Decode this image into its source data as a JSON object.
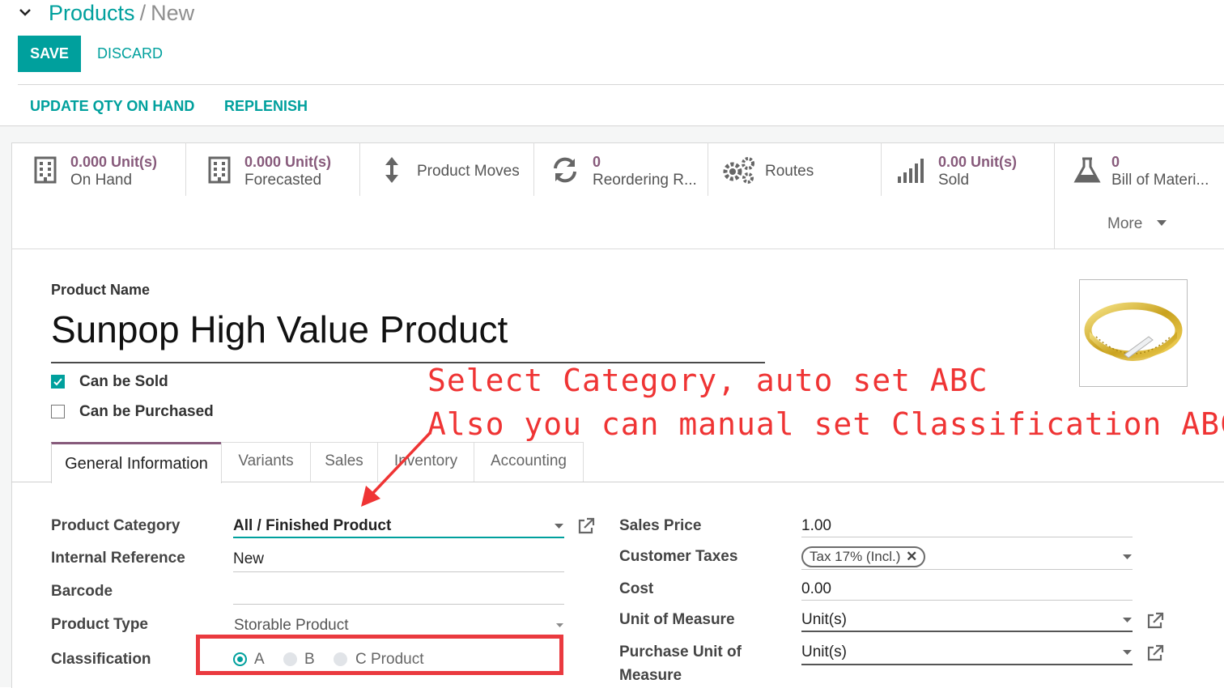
{
  "breadcrumb": {
    "parent": "Products",
    "separator": "/",
    "current": "New"
  },
  "buttons": {
    "save": "SAVE",
    "discard": "DISCARD"
  },
  "statusbar": {
    "update_qty": "UPDATE QTY ON HAND",
    "replenish": "REPLENISH"
  },
  "smart_buttons": {
    "on_hand": {
      "value": "0.000 Unit(s)",
      "label": "On Hand",
      "icon": "building-icon"
    },
    "forecasted": {
      "value": "0.000 Unit(s)",
      "label": "Forecasted",
      "icon": "building-icon"
    },
    "product_moves": {
      "label": "Product Moves",
      "icon": "up-down-arrow-icon"
    },
    "reordering": {
      "value": "0",
      "label": "Reordering R...",
      "icon": "refresh-icon"
    },
    "routes": {
      "label": "Routes",
      "icon": "gears-icon"
    },
    "sold": {
      "value": "0.00 Unit(s)",
      "label": "Sold",
      "icon": "signal-bars-icon"
    },
    "bom": {
      "value": "0",
      "label": "Bill of Materi...",
      "icon": "flask-icon"
    },
    "more": "More"
  },
  "product": {
    "name_label": "Product Name",
    "name": "Sunpop High Value Product",
    "can_be_sold": "Can be Sold",
    "can_be_purchased": "Can be Purchased",
    "can_be_sold_checked": true,
    "can_be_purchased_checked": false
  },
  "annotation": {
    "line1": "Select Category, auto set ABC",
    "line2": "Also you can manual set Classification ABC.",
    "color": "#ef3434"
  },
  "tabs": [
    "General Information",
    "Variants",
    "Sales",
    "Inventory",
    "Accounting"
  ],
  "fields_left": {
    "category_label": "Product Category",
    "category_value": "All / Finished Product",
    "internal_ref_label": "Internal Reference",
    "internal_ref_value": "New",
    "barcode_label": "Barcode",
    "product_type_label": "Product Type",
    "product_type_value": "Storable Product",
    "classification_label": "Classification",
    "classification_options": [
      "A",
      "B",
      "C Product"
    ],
    "classification_selected": "A"
  },
  "fields_right": {
    "sales_price_label": "Sales Price",
    "sales_price_value": "1.00",
    "customer_taxes_label": "Customer Taxes",
    "customer_taxes_tag": "Tax 17% (Incl.)",
    "cost_label": "Cost",
    "cost_value": "0.00",
    "uom_label": "Unit of Measure",
    "uom_value": "Unit(s)",
    "purchase_uom_label_1": "Purchase Unit of",
    "purchase_uom_label_2": "Measure",
    "purchase_uom_value": "Unit(s)"
  },
  "colors": {
    "accent": "#00a09d",
    "brand": "#875a7b",
    "highlight": "#ea3a3f"
  }
}
